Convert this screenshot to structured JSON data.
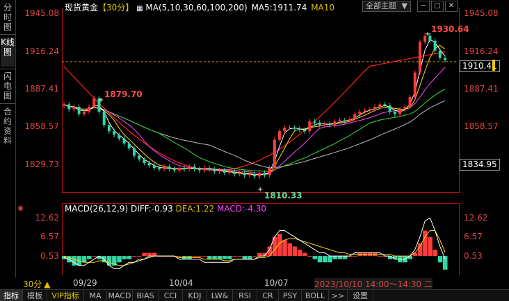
{
  "left_tabs": [
    {
      "label": "分时图",
      "active": false
    },
    {
      "label": "K线图",
      "active": true
    },
    {
      "label": "闪电图",
      "active": false
    },
    {
      "label": "合约资料",
      "active": false
    }
  ],
  "header": {
    "symbol": "现货黄金",
    "period": "【30分】",
    "ma_def": "MA(5,10,30,60,100,200)",
    "ma5": "MA5:1911.74",
    "ma10": "MA10"
  },
  "theme_button": "全部主题",
  "main_axis": {
    "ticks": [
      "1945.08",
      "1916.24",
      "1887.41",
      "1858.57",
      "1829.73"
    ],
    "right_ticks": [
      "1945.08",
      "1916.24",
      "1887.41",
      "1858.57"
    ],
    "current_price": "1910.41",
    "last_ma": "1834.95"
  },
  "annotations": {
    "high_right": "1930.64",
    "high_left": "1879.70",
    "low": "1810.33"
  },
  "macd_header": {
    "def": "MACD(26,12,9)",
    "diff": "DIFF:-0.93",
    "dea": "DEA:1.22",
    "macd": "MACD:-4.30"
  },
  "macd_axis": {
    "ticks": [
      "12.62",
      "6.57",
      "0.53"
    ]
  },
  "x_axis": {
    "period_label": "30分",
    "dates": [
      "09/29",
      "10/04",
      "10/07"
    ],
    "cursor_time": "2023/10/10 14:00～14:30 二"
  },
  "bottom_tabs": [
    "指标",
    "模板",
    "VIP指标",
    "MA",
    "MACD",
    "BIAS",
    "CCI",
    "KDJ",
    "LW&",
    "RSI",
    "CR",
    "PSY",
    "BOLL",
    ">>",
    "设置"
  ],
  "colors": {
    "up": "#ff3b3b",
    "down": "#33d6a6",
    "ma5": "#ffffff",
    "ma10": "#ffd700",
    "ma30": "#ff44ff",
    "ma60": "#33dd33",
    "ma100": "#bbbbbb",
    "ma200": "#ff2222",
    "axis": "#d44444",
    "dea": "#ffd700",
    "diff": "#ffffff"
  },
  "chart_data": {
    "type": "candlestick",
    "title": "现货黄金",
    "period": "30分",
    "price_range": [
      1805,
      1948
    ],
    "close": [
      1874,
      1870,
      1872,
      1866,
      1868,
      1872,
      1879,
      1868,
      1857,
      1852,
      1849,
      1846,
      1842,
      1838,
      1832,
      1829,
      1826,
      1824,
      1822,
      1821,
      1823,
      1821,
      1820,
      1822,
      1821,
      1823,
      1821,
      1820,
      1822,
      1821,
      1819,
      1820,
      1818,
      1819,
      1817,
      1818,
      1816,
      1817,
      1815,
      1818,
      1816,
      1822,
      1845,
      1852,
      1855,
      1855,
      1854,
      1853,
      1852,
      1860,
      1859,
      1857,
      1858,
      1857,
      1860,
      1861,
      1860,
      1862,
      1866,
      1868,
      1869,
      1870,
      1872,
      1874,
      1873,
      1868,
      1866,
      1870,
      1872,
      1880,
      1900,
      1925,
      1930,
      1926,
      1918,
      1912,
      1910
    ],
    "macd_hist": [
      -1,
      -2,
      -3,
      -3,
      -2,
      -1,
      0,
      -1,
      -2,
      -3,
      -3,
      -2,
      -1,
      -1,
      0,
      0,
      1,
      1,
      1,
      0,
      0,
      0,
      0,
      0,
      -1,
      -1,
      0,
      0,
      0,
      -1,
      -1,
      -1,
      -1,
      -1,
      0,
      0,
      -1,
      -1,
      0,
      1,
      1,
      3,
      6,
      7,
      5,
      4,
      3,
      2,
      1,
      0,
      -1,
      -2,
      -2,
      -2,
      -1,
      -1,
      -1,
      0,
      0,
      1,
      1,
      1,
      1,
      0,
      0,
      -1,
      -1,
      -2,
      -2,
      -1,
      1,
      4,
      8,
      6,
      2,
      -2,
      -4.3
    ],
    "diff": [
      -0.5,
      -1,
      -2,
      -3,
      -3,
      -2,
      -1,
      0,
      -1,
      -3,
      -4,
      -4,
      -3,
      -2,
      -2,
      -1,
      -1,
      0,
      0,
      0,
      0,
      0,
      0,
      -1,
      -1,
      -1,
      -1,
      -1,
      -2,
      -2,
      -2,
      -2,
      -2,
      -2,
      -1,
      -1,
      -1,
      -1,
      -1,
      0,
      0,
      2,
      6,
      8,
      8,
      7,
      6,
      5,
      4,
      3,
      2,
      1,
      1,
      0,
      0,
      0,
      0,
      0,
      1,
      1,
      1,
      1,
      1,
      1,
      0,
      0,
      -1,
      -1,
      -1,
      0,
      2,
      6,
      11,
      12,
      8,
      3,
      -0.93
    ],
    "dea": [
      0,
      -0.5,
      -1,
      -1.5,
      -2,
      -2,
      -2,
      -1.5,
      -1.5,
      -2,
      -2.5,
      -3,
      -3,
      -2.5,
      -2,
      -1.5,
      -1,
      -0.5,
      0,
      0,
      0,
      0,
      0,
      -0.5,
      -0.5,
      -0.5,
      -0.5,
      -0.5,
      -1,
      -1,
      -1,
      -1,
      -1.5,
      -1.5,
      -1,
      -1,
      -1,
      -1,
      -1,
      -0.5,
      -0.5,
      0,
      2,
      4,
      5,
      5.5,
      5.5,
      5,
      4.5,
      4,
      3.5,
      3,
      2.5,
      2,
      1.5,
      1,
      1,
      0.5,
      0.5,
      0.5,
      0.5,
      0.5,
      0.5,
      0.5,
      0.5,
      0.5,
      0,
      0,
      0,
      0,
      1,
      3,
      6,
      8,
      8,
      5,
      1.22
    ],
    "macd_range": [
      -5,
      14
    ]
  }
}
